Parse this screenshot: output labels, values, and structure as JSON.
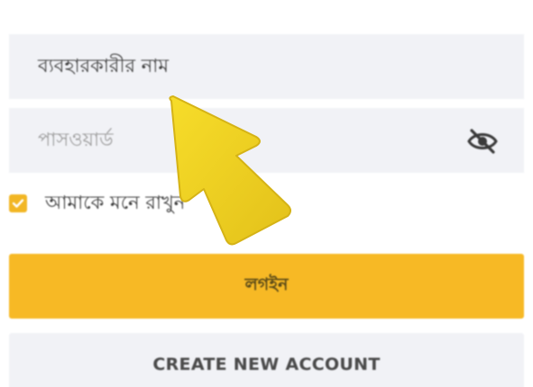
{
  "login_form": {
    "username_value": "ব্যবহারকারীর নাম",
    "password_placeholder": "পাসওয়ার্ড",
    "remember_me_label": "আমাকে মনে রাখুন",
    "remember_me_checked": true,
    "login_button_label": "লগইন",
    "create_account_label": "CREATE NEW ACCOUNT"
  },
  "colors": {
    "accent": "#f7b925",
    "field_bg": "#f1f2f6",
    "arrow": "#f3d21a"
  },
  "icons": {
    "password_toggle": "eye-slash-icon",
    "checkbox": "check-icon",
    "pointer": "arrow-pointer-icon"
  }
}
